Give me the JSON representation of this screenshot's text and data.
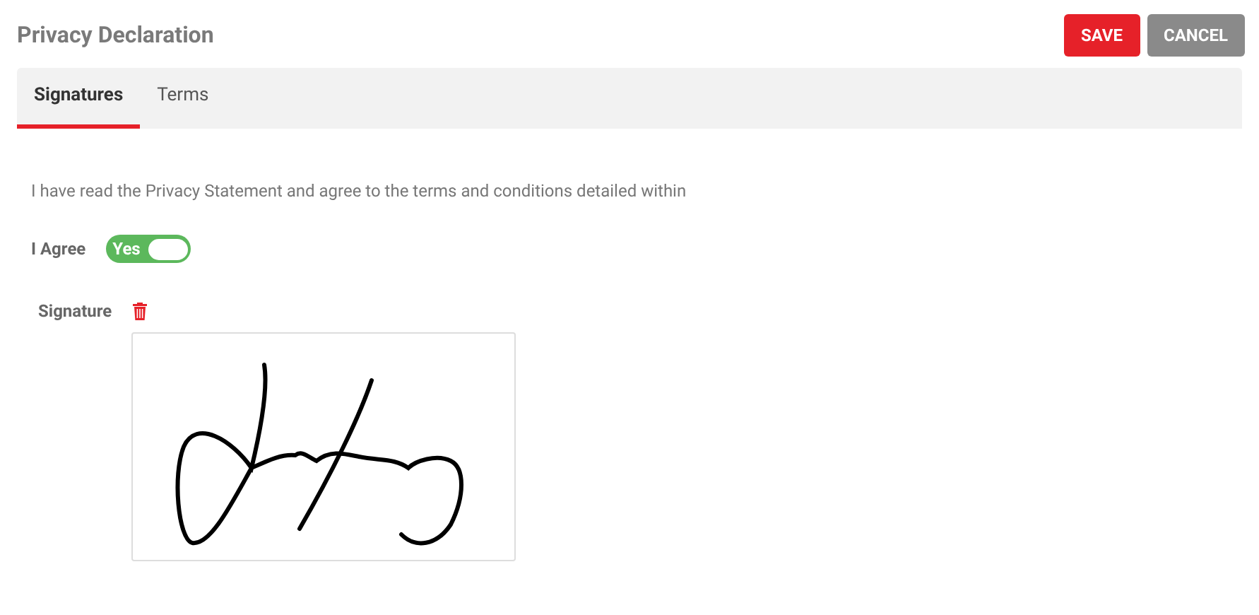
{
  "title": "Privacy Declaration",
  "buttons": [
    {
      "label": "SAVE",
      "kind": "primary"
    },
    {
      "label": "CANCEL",
      "kind": "secondary"
    }
  ],
  "tabs": [
    {
      "label": "Signatures",
      "selected": true
    },
    {
      "label": "Terms",
      "selected": false
    }
  ],
  "statement": "I have read the Privacy Statement and agree to the terms and conditions detailed within",
  "agree": {
    "label": "I Agree",
    "on": true,
    "on_text": "Yes"
  },
  "signature": {
    "label": "Signature"
  }
}
